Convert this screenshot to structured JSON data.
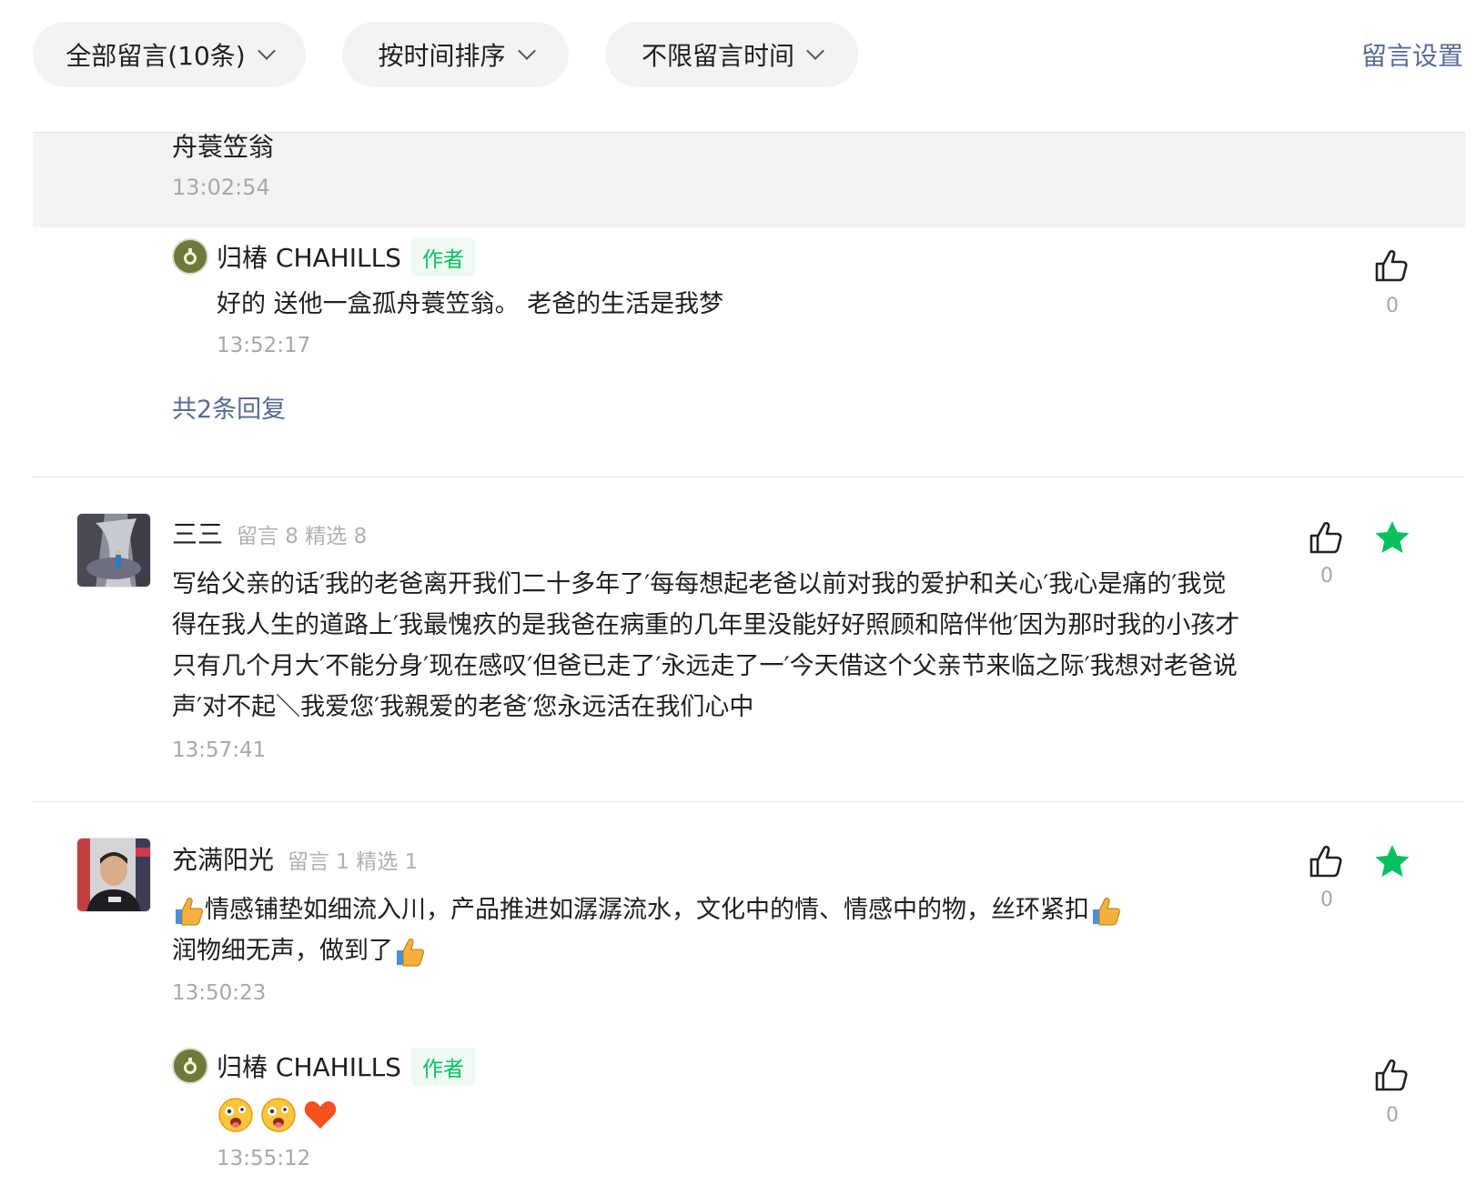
{
  "filters": {
    "all_comments": "全部留言(10条)",
    "sort": "按时间排序",
    "time_range": "不限留言时间",
    "settings": "留言设置"
  },
  "previous": {
    "text": "舟蓑笠翁",
    "time": "13:02:54"
  },
  "reply1": {
    "name": "归椿 CHAHILLS",
    "tag": "作者",
    "text": "好的 送他一盒孤舟蓑笠翁。 老爸的生活是我梦",
    "time": "13:52:17",
    "likes": "0",
    "reply_count": "共2条回复"
  },
  "comment1": {
    "name": "三三",
    "stats": "留言 8  精选 8",
    "line1": "写给父亲的话′我的老爸离开我们二十多年了′每每想起老爸以前对我的爱护和关心′我心是痛的′我觉",
    "line2": "得在我人生的道路上′我最愧疚的是我爸在病重的几年里没能好好照顾和陪伴他′因为那时我的小孩才",
    "line3": "只有几个月大′不能分身′现在感叹′但爸已走了′永远走了一′今天借这个父亲节来临之际′我想对老爸说",
    "line4": "声′对不起＼我爱您′我親爱的老爸′您永远活在我们心中",
    "time": "13:57:41",
    "likes": "0"
  },
  "comment2": {
    "name": "充满阳光",
    "stats": "留言 1  精选 1",
    "line1": "情感铺垫如细流入川，产品推进如潺潺流水，文化中的情、情感中的物，丝环紧扣",
    "line2": "润物细无声，做到了",
    "time": "13:50:23",
    "likes": "0"
  },
  "reply2": {
    "name": "归椿 CHAHILLS",
    "tag": "作者",
    "time": "13:55:12",
    "likes": "0"
  },
  "colors": {
    "link": "#576b95",
    "star": "#07c160",
    "author_tag": "#07c160"
  }
}
